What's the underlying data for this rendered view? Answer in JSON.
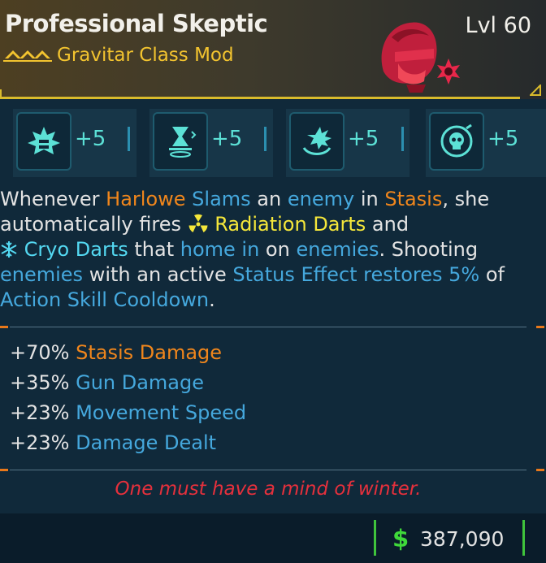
{
  "item": {
    "name": "Professional Skeptic",
    "type_label": "Gravitar Class Mod",
    "level": "Lvl 60"
  },
  "colors": {
    "rarity": "#f3c42f",
    "accent_blue": "#45a8dd",
    "accent_orange": "#f0861c",
    "radiation": "#f5e73a",
    "cryo": "#54d9f2",
    "flavor": "#e5303c",
    "currency": "#3fd93a"
  },
  "skills": [
    {
      "icon": "cluster-leaf-icon",
      "bonus": "+5"
    },
    {
      "icon": "hourglass-device-icon",
      "bonus": "+5"
    },
    {
      "icon": "impact-burst-icon",
      "bonus": "+5"
    },
    {
      "icon": "skull-target-icon",
      "bonus": "+5"
    }
  ],
  "description": {
    "l1": [
      "Whenever ",
      "Harlowe",
      " ",
      "Slams",
      " an ",
      "enemy",
      " in ",
      "Stasis",
      ", she"
    ],
    "l2": [
      "automatically fires ",
      "Radiation Darts",
      " and"
    ],
    "l3": [
      "Cryo Darts",
      " that ",
      "home in",
      " on ",
      "enemies",
      ". Shooting"
    ],
    "l4": [
      "enemies",
      " with an active ",
      "Status Effect restores 5%",
      " of"
    ],
    "l5": [
      "Action Skill Cooldown",
      "."
    ]
  },
  "stats": [
    {
      "value": "+70%",
      "name": "Stasis Damage"
    },
    {
      "value": "+35%",
      "name": "Gun Damage"
    },
    {
      "value": "+23%",
      "name": "Movement Speed"
    },
    {
      "value": "+23%",
      "name": "Damage Dealt"
    }
  ],
  "flavor_text": "One must have a mind of winter.",
  "price": {
    "currency_symbol": "$",
    "amount": "387,090"
  }
}
